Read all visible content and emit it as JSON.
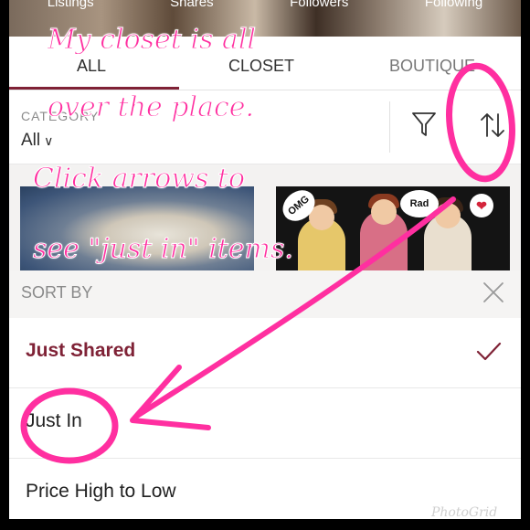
{
  "top_strip": {
    "stats": [
      "Listings",
      "Shares",
      "Followers",
      "Following"
    ]
  },
  "tabs": [
    {
      "label": "ALL",
      "active": true
    },
    {
      "label": "CLOSET",
      "active": false
    },
    {
      "label": "BOUTIQUE",
      "active": false
    }
  ],
  "filter_bar": {
    "category_label": "CATEGORY",
    "category_value": "All",
    "icons": [
      "filter-icon",
      "sort-icon"
    ]
  },
  "listings": {
    "tile2_bubbles": [
      "OMG",
      "Rad"
    ]
  },
  "sort_sheet": {
    "title": "SORT BY",
    "options": [
      {
        "label": "Just Shared",
        "selected": true
      },
      {
        "label": "Just In",
        "selected": false
      },
      {
        "label": "Price High to Low",
        "selected": false
      }
    ]
  },
  "annotation": {
    "color": "#ff2fa0",
    "lines": [
      "My closet is all",
      "over the place.",
      "Click arrows to",
      "see \"just in\" items."
    ]
  },
  "watermark": "PhotoGrid",
  "colors": {
    "accent": "#7f2236",
    "divider": "#e8e8e8"
  }
}
